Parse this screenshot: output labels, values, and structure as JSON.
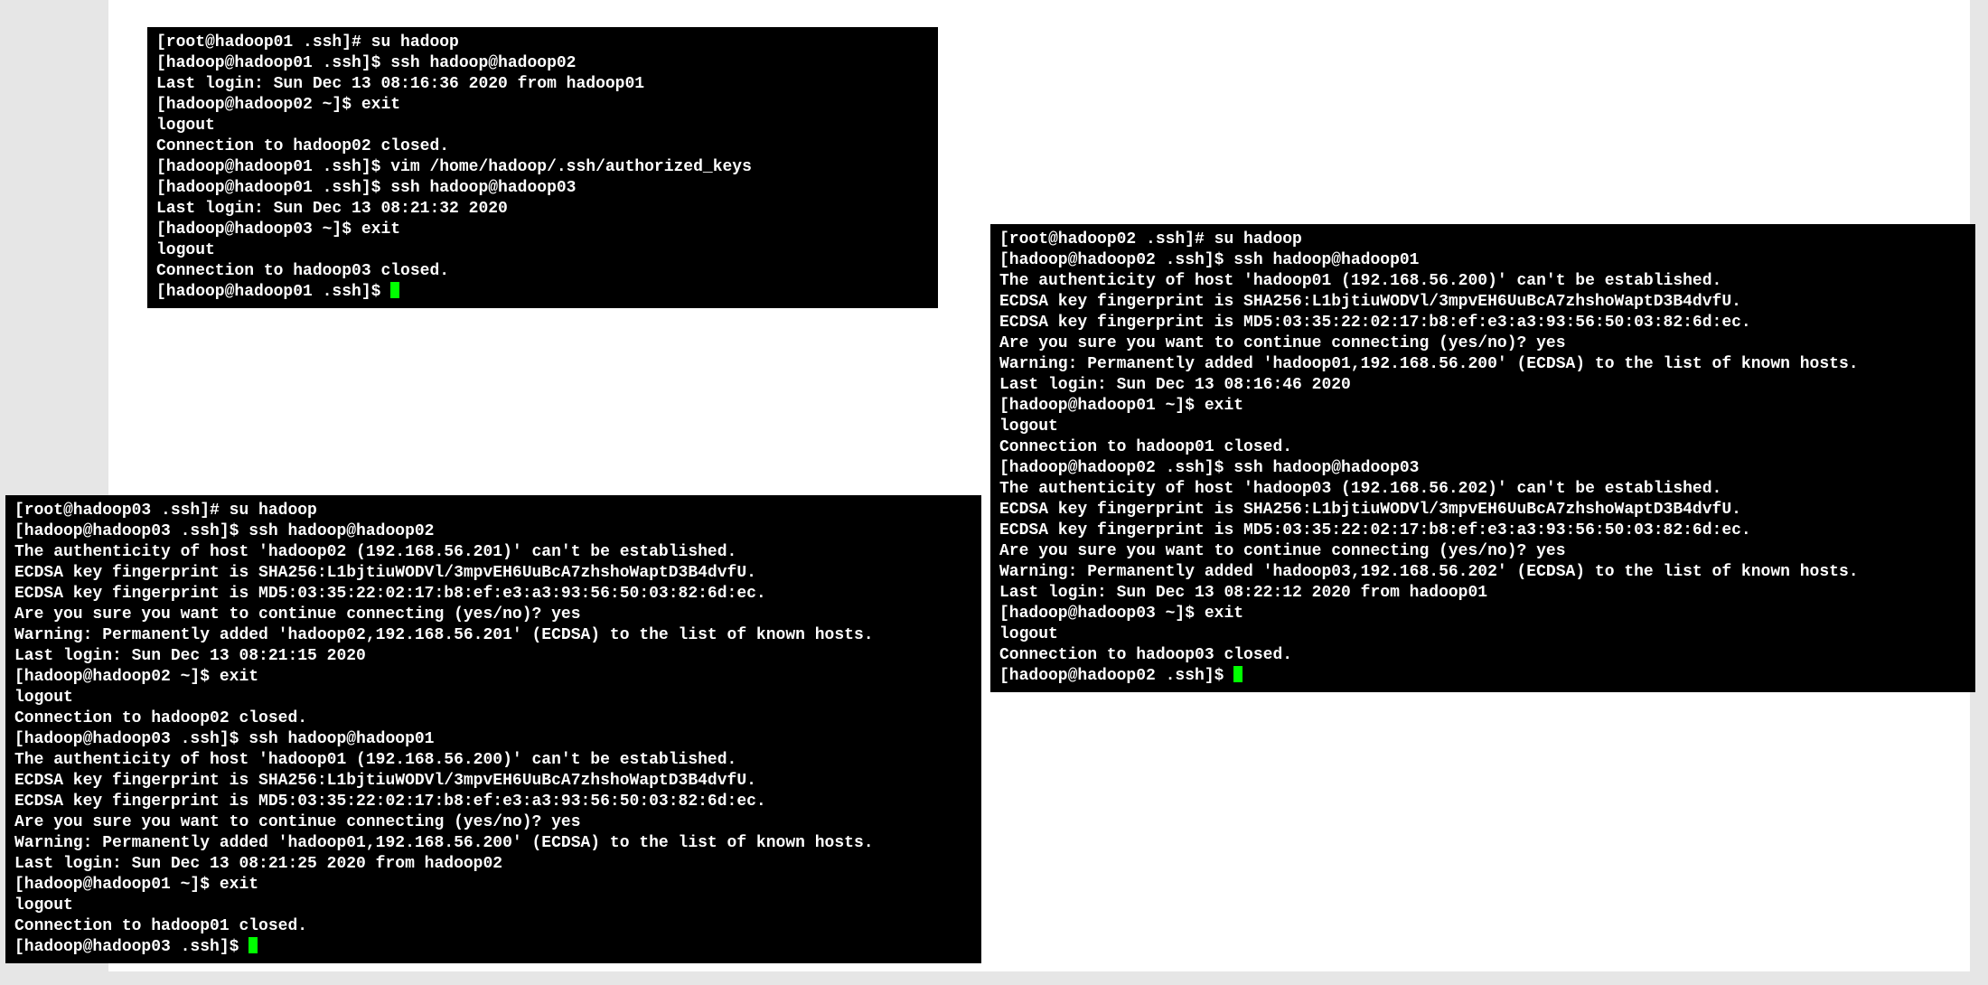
{
  "terminals": {
    "t1": {
      "lines": [
        "[root@hadoop01 .ssh]# su hadoop",
        "[hadoop@hadoop01 .ssh]$ ssh hadoop@hadoop02",
        "Last login: Sun Dec 13 08:16:36 2020 from hadoop01",
        "[hadoop@hadoop02 ~]$ exit",
        "logout",
        "Connection to hadoop02 closed.",
        "[hadoop@hadoop01 .ssh]$ vim /home/hadoop/.ssh/authorized_keys",
        "[hadoop@hadoop01 .ssh]$ ssh hadoop@hadoop03",
        "Last login: Sun Dec 13 08:21:32 2020",
        "[hadoop@hadoop03 ~]$ exit",
        "logout",
        "Connection to hadoop03 closed.",
        "[hadoop@hadoop01 .ssh]$ "
      ]
    },
    "t2": {
      "lines": [
        "[root@hadoop02 .ssh]# su hadoop",
        "[hadoop@hadoop02 .ssh]$ ssh hadoop@hadoop01",
        "The authenticity of host 'hadoop01 (192.168.56.200)' can't be established.",
        "ECDSA key fingerprint is SHA256:L1bjtiuWODVl/3mpvEH6UuBcA7zhshoWaptD3B4dvfU.",
        "ECDSA key fingerprint is MD5:03:35:22:02:17:b8:ef:e3:a3:93:56:50:03:82:6d:ec.",
        "Are you sure you want to continue connecting (yes/no)? yes",
        "Warning: Permanently added 'hadoop01,192.168.56.200' (ECDSA) to the list of known hosts.",
        "Last login: Sun Dec 13 08:16:46 2020",
        "[hadoop@hadoop01 ~]$ exit",
        "logout",
        "Connection to hadoop01 closed.",
        "[hadoop@hadoop02 .ssh]$ ssh hadoop@hadoop03",
        "The authenticity of host 'hadoop03 (192.168.56.202)' can't be established.",
        "ECDSA key fingerprint is SHA256:L1bjtiuWODVl/3mpvEH6UuBcA7zhshoWaptD3B4dvfU.",
        "ECDSA key fingerprint is MD5:03:35:22:02:17:b8:ef:e3:a3:93:56:50:03:82:6d:ec.",
        "Are you sure you want to continue connecting (yes/no)? yes",
        "Warning: Permanently added 'hadoop03,192.168.56.202' (ECDSA) to the list of known hosts.",
        "Last login: Sun Dec 13 08:22:12 2020 from hadoop01",
        "[hadoop@hadoop03 ~]$ exit",
        "logout",
        "Connection to hadoop03 closed.",
        "[hadoop@hadoop02 .ssh]$ "
      ]
    },
    "t3": {
      "lines": [
        "[root@hadoop03 .ssh]# su hadoop",
        "[hadoop@hadoop03 .ssh]$ ssh hadoop@hadoop02",
        "The authenticity of host 'hadoop02 (192.168.56.201)' can't be established.",
        "ECDSA key fingerprint is SHA256:L1bjtiuWODVl/3mpvEH6UuBcA7zhshoWaptD3B4dvfU.",
        "ECDSA key fingerprint is MD5:03:35:22:02:17:b8:ef:e3:a3:93:56:50:03:82:6d:ec.",
        "Are you sure you want to continue connecting (yes/no)? yes",
        "Warning: Permanently added 'hadoop02,192.168.56.201' (ECDSA) to the list of known hosts.",
        "Last login: Sun Dec 13 08:21:15 2020",
        "[hadoop@hadoop02 ~]$ exit",
        "logout",
        "Connection to hadoop02 closed.",
        "[hadoop@hadoop03 .ssh]$ ssh hadoop@hadoop01",
        "The authenticity of host 'hadoop01 (192.168.56.200)' can't be established.",
        "ECDSA key fingerprint is SHA256:L1bjtiuWODVl/3mpvEH6UuBcA7zhshoWaptD3B4dvfU.",
        "ECDSA key fingerprint is MD5:03:35:22:02:17:b8:ef:e3:a3:93:56:50:03:82:6d:ec.",
        "Are you sure you want to continue connecting (yes/no)? yes",
        "Warning: Permanently added 'hadoop01,192.168.56.200' (ECDSA) to the list of known hosts.",
        "Last login: Sun Dec 13 08:21:25 2020 from hadoop02",
        "[hadoop@hadoop01 ~]$ exit",
        "logout",
        "Connection to hadoop01 closed.",
        "[hadoop@hadoop03 .ssh]$ "
      ]
    }
  }
}
